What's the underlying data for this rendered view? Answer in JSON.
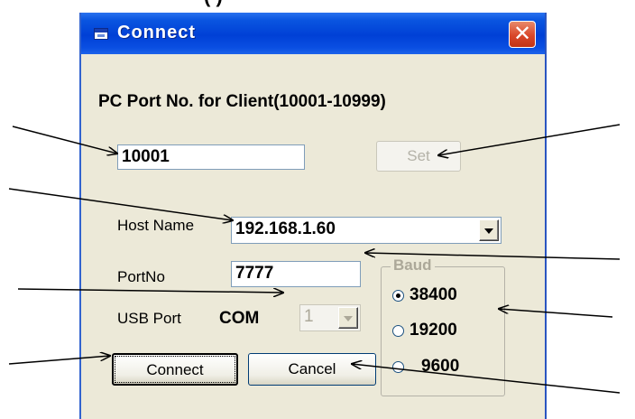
{
  "page_header": "(      )",
  "dialog": {
    "title": "Connect",
    "close_glyph": "✕",
    "client_port_label": "PC Port No. for Client(10001-10999)",
    "client_port_value": "10001",
    "set_label": "Set",
    "host_name_label": "Host Name",
    "host_name_value": "192.168.1.60",
    "port_no_label": "PortNo",
    "port_no_value": "7777",
    "usb_port_label": "USB Port",
    "com_label": "COM",
    "com_value": "1",
    "baud": {
      "legend": "Baud",
      "options": [
        {
          "label": "38400",
          "checked": true
        },
        {
          "label": "19200",
          "checked": false
        },
        {
          "label": "9600",
          "checked": false
        }
      ]
    },
    "connect_label": "Connect",
    "cancel_label": "Cancel"
  },
  "colors": {
    "titlebar": "#0040d6",
    "dialog_bg": "#ece9d8",
    "close_button": "#d9472a"
  },
  "icons": {
    "app": "window-icon",
    "close": "close-icon",
    "dropdown": "chevron-down-icon"
  }
}
